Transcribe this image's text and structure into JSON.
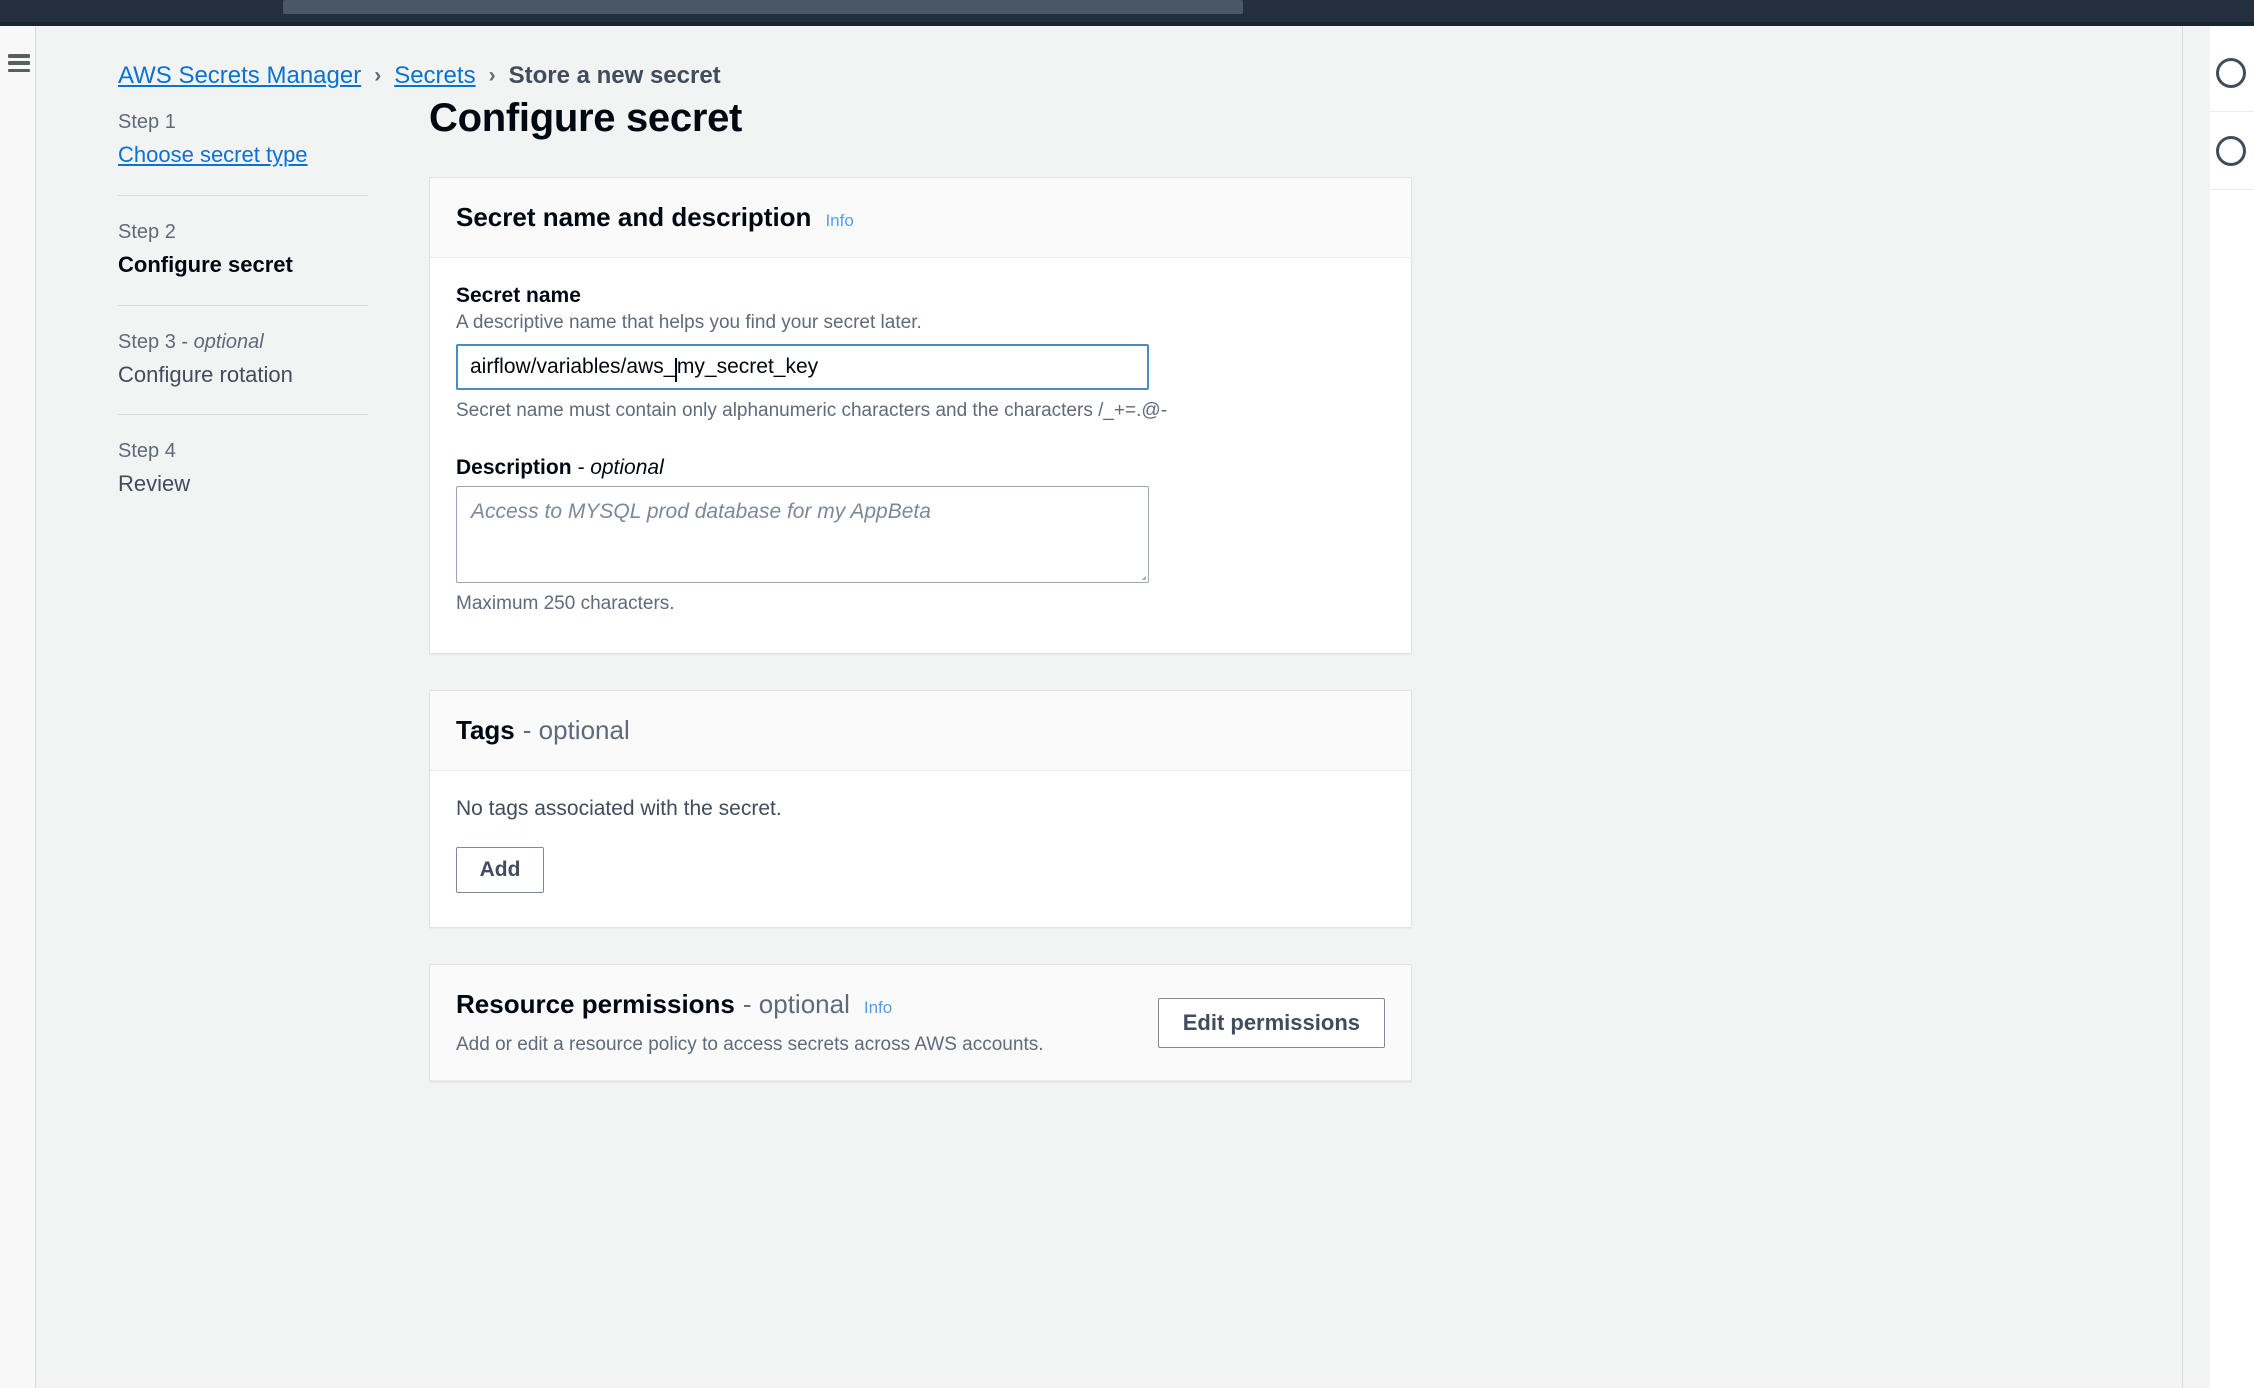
{
  "topbar": {
    "search_placeholder": ""
  },
  "left_rail": {
    "menu_icon": "hamburger-icon"
  },
  "right_rail": {
    "icons": [
      "circle-icon",
      "circle-icon"
    ]
  },
  "breadcrumb": {
    "items": [
      {
        "label": "AWS Secrets Manager",
        "type": "link"
      },
      {
        "label": "Secrets",
        "type": "link"
      },
      {
        "label": "Store a new secret",
        "type": "current"
      }
    ],
    "separator": "›"
  },
  "steps": [
    {
      "number": "Step 1",
      "label": "Choose secret type",
      "state": "link"
    },
    {
      "number": "Step 2",
      "label": "Configure secret",
      "state": "active"
    },
    {
      "number": "Step 3 - ",
      "number_optional": "optional",
      "label": "Configure rotation",
      "state": "pending"
    },
    {
      "number": "Step 4",
      "label": "Review",
      "state": "pending"
    }
  ],
  "main": {
    "page_title": "Configure secret",
    "secret_section": {
      "title": "Secret name and description",
      "info_label": "Info",
      "secret_name": {
        "label": "Secret name",
        "description": "A descriptive name that helps you find your secret later.",
        "value": "airflow/variables/aws_my_secret_key",
        "value_before_caret": "airflow/variables/aws_",
        "value_after_caret": "my_secret_key",
        "constraint": "Secret name must contain only alphanumeric characters and the characters /_+=.@-"
      },
      "description_field": {
        "label": "Description",
        "optional_suffix": "- optional",
        "placeholder": "Access to MYSQL prod database for my AppBeta",
        "constraint": "Maximum 250 characters."
      }
    },
    "tags_section": {
      "title": "Tags",
      "title_suffix": "- optional",
      "empty_text": "No tags associated with the secret.",
      "add_label": "Add"
    },
    "resource_permissions_section": {
      "title": "Resource permissions",
      "title_suffix": "- optional",
      "info_label": "Info",
      "subtitle": "Add or edit a resource policy to access secrets across AWS accounts.",
      "edit_label": "Edit permissions"
    }
  },
  "colors": {
    "topbar": "#232f3e",
    "link": "#0972d3",
    "info_link": "#539fe5",
    "focus_border": "#4b8bbd",
    "page_bg": "#f2f3f3",
    "card_bg": "#ffffff",
    "text": "#000811",
    "muted_text": "#5f6b7a"
  }
}
